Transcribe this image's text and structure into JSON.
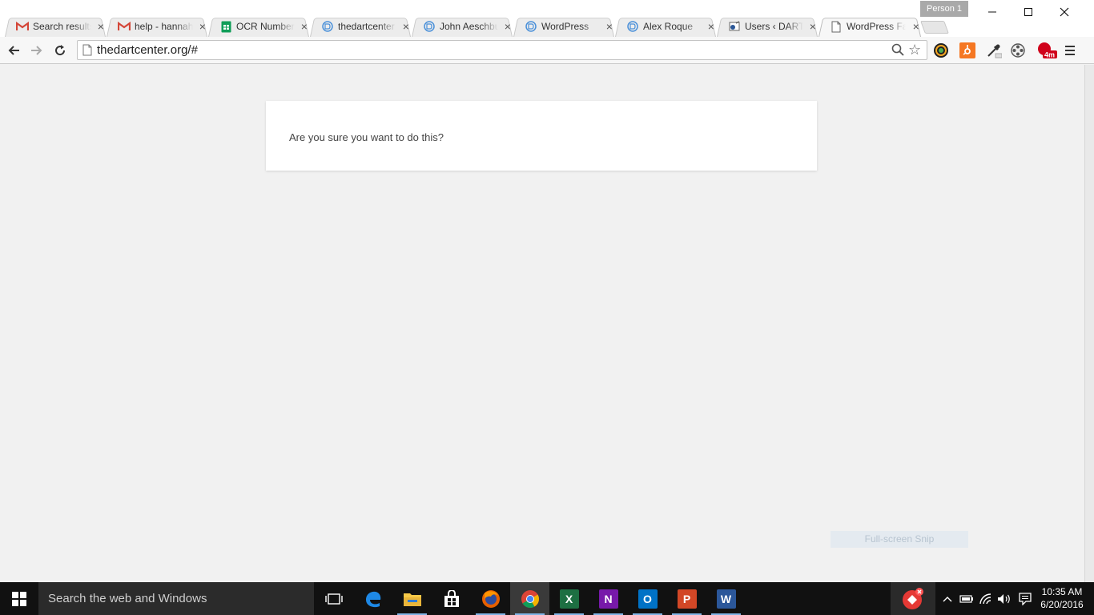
{
  "window": {
    "profile_name": "Person 1"
  },
  "tabs": [
    {
      "title": "Search results",
      "icon": "gmail-icon"
    },
    {
      "title": "help - hannah",
      "icon": "gmail-icon"
    },
    {
      "title": "OCR Numbers",
      "icon": "sheets-icon"
    },
    {
      "title": "thedartcenter",
      "icon": "site-icon"
    },
    {
      "title": "John Aeschbu",
      "icon": "site-icon"
    },
    {
      "title": "WordPress",
      "icon": "site-icon"
    },
    {
      "title": "Alex Roque",
      "icon": "site-icon"
    },
    {
      "title": "Users ‹ DART",
      "icon": "wp-admin-icon"
    },
    {
      "title": "WordPress Fa",
      "icon": "page-icon",
      "active": true
    }
  ],
  "toolbar": {
    "url": "thedartcenter.org/#",
    "extension_badge": "4m"
  },
  "page": {
    "message": "Are you sure you want to do this?"
  },
  "overlay": {
    "snip_label": "Full-screen Snip"
  },
  "taskbar": {
    "search_placeholder": "Search the web and Windows",
    "apps": [
      "task-view",
      "edge",
      "file-explorer",
      "store",
      "firefox",
      "chrome",
      "excel",
      "onenote",
      "outlook",
      "powerpoint",
      "word"
    ],
    "active_app": "chrome",
    "excel_letter": "X",
    "onenote_letter": "N",
    "outlook_letter": "O",
    "powerpoint_letter": "P",
    "word_letter": "W"
  },
  "clock": {
    "time": "10:35 AM",
    "date": "6/20/2016"
  },
  "colors": {
    "accent_blue": "#4a90d9",
    "gmail_red": "#d44638",
    "sheets_green": "#0f9d58",
    "taskbar": "#111111"
  }
}
